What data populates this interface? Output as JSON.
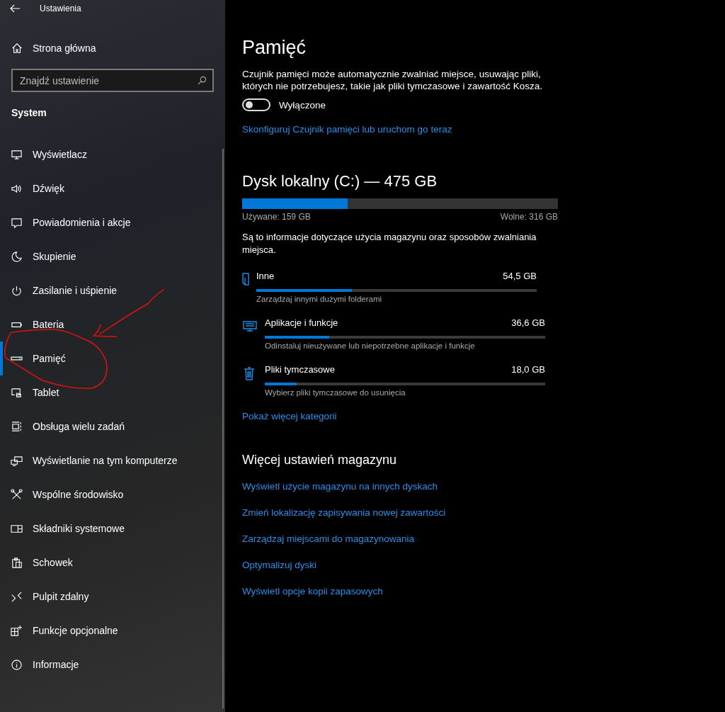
{
  "window": {
    "title": "Ustawienia"
  },
  "sidebar": {
    "home": "Strona główna",
    "search": {
      "placeholder": "Znajdź ustawienie"
    },
    "section": "System",
    "items": [
      {
        "label": "Wyświetlacz",
        "selected": false
      },
      {
        "label": "Dźwięk",
        "selected": false
      },
      {
        "label": "Powiadomienia i akcje",
        "selected": false
      },
      {
        "label": "Skupienie",
        "selected": false
      },
      {
        "label": "Zasilanie i uśpienie",
        "selected": false
      },
      {
        "label": "Bateria",
        "selected": false
      },
      {
        "label": "Pamięć",
        "selected": true
      },
      {
        "label": "Tablet",
        "selected": false
      },
      {
        "label": "Obsługa wielu zadań",
        "selected": false
      },
      {
        "label": "Wyświetlanie na tym komputerze",
        "selected": false
      },
      {
        "label": "Wspólne środowisko",
        "selected": false
      },
      {
        "label": "Składniki systemowe",
        "selected": false
      },
      {
        "label": "Schowek",
        "selected": false
      },
      {
        "label": "Pulpit zdalny",
        "selected": false
      },
      {
        "label": "Funkcje opcjonalne",
        "selected": false
      },
      {
        "label": "Informacje",
        "selected": false
      }
    ]
  },
  "main": {
    "title": "Pamięć",
    "description": "Czujnik pamięci może automatycznie zwalniać miejsce, usuwając pliki, których nie potrzebujesz, takie jak pliki tymczasowe i zawartość Kosza.",
    "toggle": {
      "on": false,
      "label": "Wyłączone"
    },
    "configure_link": "Skonfiguruj Czujnik pamięci lub uruchom go teraz",
    "disk": {
      "title": "Dysk lokalny (C:) — 475 GB",
      "level": 0.335,
      "used": "Używane: 159 GB",
      "free": "Wolne: 316 GB"
    },
    "info": "Są to informacje dotyczące użycia magazynu oraz sposobów zwalniania miejsca.",
    "categories": [
      {
        "kind": "other",
        "name": "Inne",
        "size": "54,5 GB",
        "level": 0.34,
        "hint": "Zarządzaj innymi dużymi folderami"
      },
      {
        "kind": "apps",
        "name": "Aplikacje i funkcje",
        "size": "36,6 GB",
        "level": 0.23,
        "hint": "Odinstaluj nieużywane lub niepotrzebne aplikacje i funkcje"
      },
      {
        "kind": "temp",
        "name": "Pliki tymczasowe",
        "size": "18,0 GB",
        "level": 0.114,
        "hint": "Wybierz pliki tymczasowe do usunięcia"
      }
    ],
    "more_link": "Pokaż więcej kategorii",
    "more_settings": {
      "title": "Więcej ustawień magazynu",
      "links": [
        "Wyświetl użycie magazynu na innych dyskach",
        "Zmień lokalizację zapisywania nowej zawartości",
        "Zarządzaj miejscami do magazynowania",
        "Optymalizuj dyski",
        "Wyświetl opcje kopii zapasowych"
      ]
    }
  }
}
